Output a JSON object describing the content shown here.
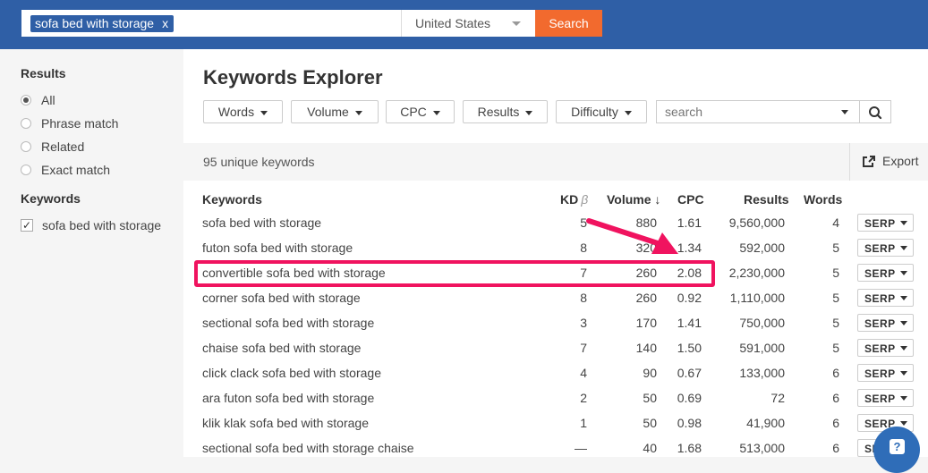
{
  "header": {
    "search_tag": "sofa bed with storage",
    "tag_remove": "x",
    "country": "United States",
    "search_button": "Search"
  },
  "sidebar": {
    "results_heading": "Results",
    "results_options": [
      {
        "label": "All",
        "selected": true
      },
      {
        "label": "Phrase match",
        "selected": false
      },
      {
        "label": "Related",
        "selected": false
      },
      {
        "label": "Exact match",
        "selected": false
      }
    ],
    "keywords_heading": "Keywords",
    "keyword_filters": [
      {
        "label": "sofa bed with storage",
        "checked": true
      }
    ]
  },
  "main": {
    "title": "Keywords Explorer",
    "filters": [
      "Words",
      "Volume",
      "CPC",
      "Results",
      "Difficulty"
    ],
    "search_placeholder": "search",
    "summary": "95 unique keywords",
    "export_label": "Export",
    "columns": {
      "keyword": "Keywords",
      "kd": "KD",
      "kd_badge": "β",
      "volume": "Volume",
      "sort_arrow": "↓",
      "cpc": "CPC",
      "results": "Results",
      "words": "Words"
    },
    "serp_label": "SERP",
    "rows": [
      {
        "keyword": "sofa bed with storage",
        "kd": "5",
        "volume": "880",
        "cpc": "1.61",
        "results": "9,560,000",
        "words": "4"
      },
      {
        "keyword": "futon sofa bed with storage",
        "kd": "8",
        "volume": "320",
        "cpc": "1.34",
        "results": "592,000",
        "words": "5"
      },
      {
        "keyword": "convertible sofa bed with storage",
        "kd": "7",
        "volume": "260",
        "cpc": "2.08",
        "results": "2,230,000",
        "words": "5"
      },
      {
        "keyword": "corner sofa bed with storage",
        "kd": "8",
        "volume": "260",
        "cpc": "0.92",
        "results": "1,110,000",
        "words": "5"
      },
      {
        "keyword": "sectional sofa bed with storage",
        "kd": "3",
        "volume": "170",
        "cpc": "1.41",
        "results": "750,000",
        "words": "5"
      },
      {
        "keyword": "chaise sofa bed with storage",
        "kd": "7",
        "volume": "140",
        "cpc": "1.50",
        "results": "591,000",
        "words": "5"
      },
      {
        "keyword": "click clack sofa bed with storage",
        "kd": "4",
        "volume": "90",
        "cpc": "0.67",
        "results": "133,000",
        "words": "6"
      },
      {
        "keyword": "ara futon sofa bed with storage",
        "kd": "2",
        "volume": "50",
        "cpc": "0.69",
        "results": "72",
        "words": "6"
      },
      {
        "keyword": "klik klak sofa bed with storage",
        "kd": "1",
        "volume": "50",
        "cpc": "0.98",
        "results": "41,900",
        "words": "6"
      },
      {
        "keyword": "sectional sofa bed with storage chaise",
        "kd": "—",
        "volume": "40",
        "cpc": "1.68",
        "results": "513,000",
        "words": "6"
      }
    ],
    "highlighted_row": 2
  },
  "help_label": "?",
  "colors": {
    "header_blue": "#2f5fa6",
    "search_orange": "#f26a2e",
    "highlight_pink": "#f0135f",
    "help_blue": "#2f6db8"
  }
}
